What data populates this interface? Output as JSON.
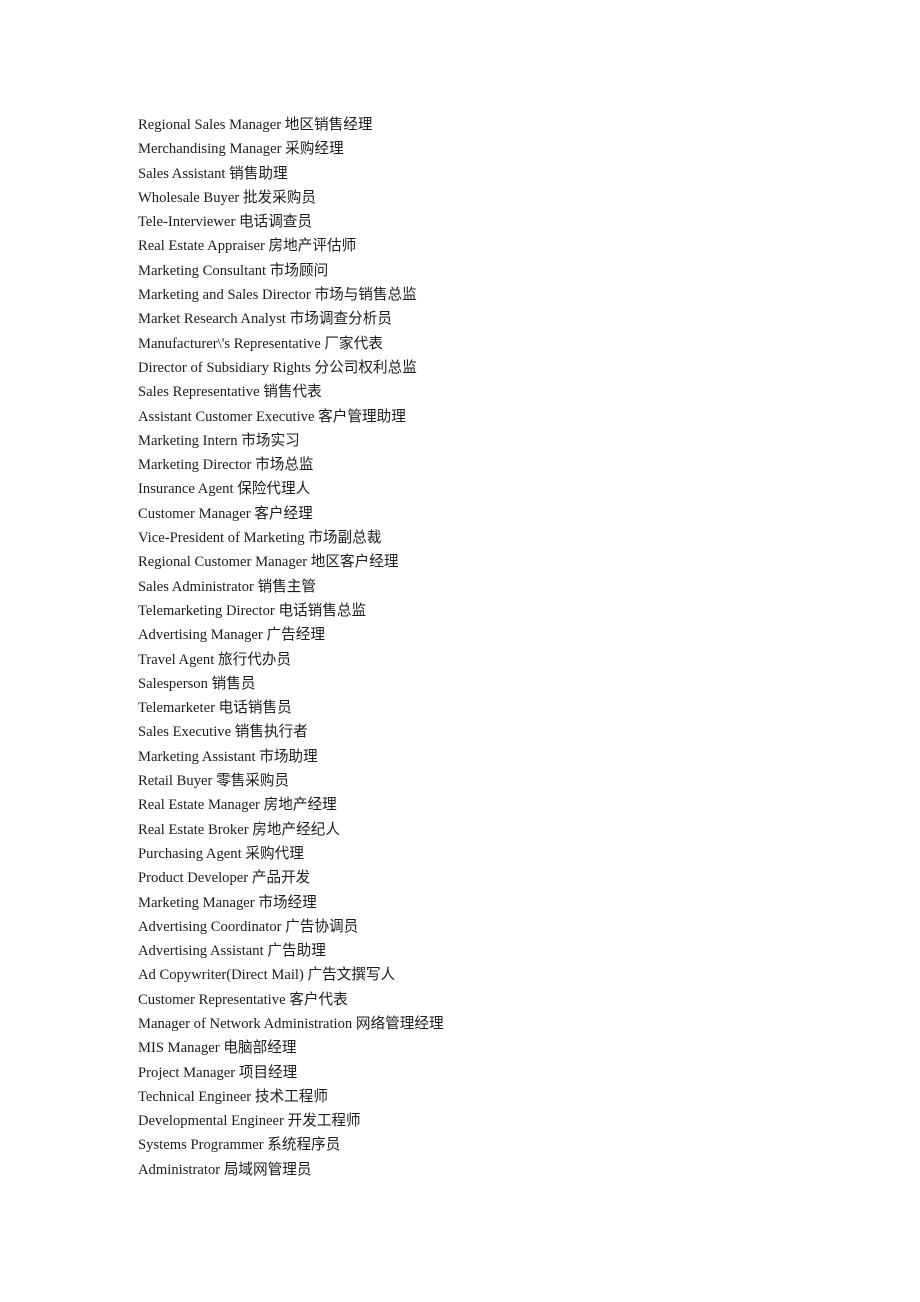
{
  "document": {
    "page_background": "#ffffff",
    "text_color": "#1c1c1c",
    "entries": [
      {
        "en": "Regional Sales Manager",
        "zh": "地区销售经理"
      },
      {
        "en": "Merchandising Manager",
        "zh": "采购经理"
      },
      {
        "en": "Sales Assistant",
        "zh": "销售助理"
      },
      {
        "en": "Wholesale Buyer",
        "zh": "批发采购员"
      },
      {
        "en": "Tele-Interviewer",
        "zh": "电话调查员"
      },
      {
        "en": "Real Estate Appraiser",
        "zh": "房地产评估师"
      },
      {
        "en": "Marketing Consultant",
        "zh": "市场顾问"
      },
      {
        "en": "Marketing and Sales Director",
        "zh": "市场与销售总监"
      },
      {
        "en": "Market Research Analyst",
        "zh": "市场调查分析员"
      },
      {
        "en": "Manufacturer\\'s Representative",
        "zh": "厂家代表"
      },
      {
        "en": "Director of Subsidiary Rights",
        "zh": "分公司权利总监"
      },
      {
        "en": "Sales Representative",
        "zh": "销售代表"
      },
      {
        "en": "Assistant Customer Executive",
        "zh": "客户管理助理"
      },
      {
        "en": "Marketing Intern",
        "zh": "市场实习"
      },
      {
        "en": "Marketing Director",
        "zh": "市场总监"
      },
      {
        "en": "Insurance Agent",
        "zh": "保险代理人"
      },
      {
        "en": "Customer Manager",
        "zh": "客户经理"
      },
      {
        "en": "Vice-President of Marketing",
        "zh": "市场副总裁"
      },
      {
        "en": "Regional Customer Manager",
        "zh": "地区客户经理"
      },
      {
        "en": "Sales Administrator",
        "zh": "销售主管"
      },
      {
        "en": "Telemarketing Director",
        "zh": "电话销售总监"
      },
      {
        "en": "Advertising Manager",
        "zh": "广告经理"
      },
      {
        "en": "Travel Agent",
        "zh": "旅行代办员"
      },
      {
        "en": "Salesperson",
        "zh": "销售员"
      },
      {
        "en": "Telemarketer",
        "zh": "电话销售员"
      },
      {
        "en": "Sales Executive",
        "zh": "销售执行者"
      },
      {
        "en": "Marketing Assistant",
        "zh": "市场助理"
      },
      {
        "en": "Retail Buyer",
        "zh": "零售采购员"
      },
      {
        "en": "Real Estate Manager",
        "zh": "房地产经理"
      },
      {
        "en": "Real Estate Broker",
        "zh": "房地产经纪人"
      },
      {
        "en": "Purchasing Agent",
        "zh": "采购代理"
      },
      {
        "en": "Product Developer",
        "zh": "产品开发"
      },
      {
        "en": "Marketing Manager",
        "zh": "市场经理"
      },
      {
        "en": "Advertising Coordinator",
        "zh": "广告协调员"
      },
      {
        "en": "Advertising Assistant",
        "zh": "广告助理"
      },
      {
        "en": "Ad Copywriter(Direct Mail)",
        "zh": "广告文撰写人"
      },
      {
        "en": "Customer Representative",
        "zh": "客户代表"
      },
      {
        "en": "Manager of Network Administration",
        "zh": "网络管理经理"
      },
      {
        "en": "MIS Manager",
        "zh": "电脑部经理"
      },
      {
        "en": "Project Manager",
        "zh": "项目经理"
      },
      {
        "en": "Technical Engineer",
        "zh": "技术工程师"
      },
      {
        "en": "Developmental Engineer",
        "zh": "开发工程师"
      },
      {
        "en": "Systems Programmer",
        "zh": "系统程序员"
      },
      {
        "en": "Administrator",
        "zh": "局域网管理员"
      }
    ]
  }
}
